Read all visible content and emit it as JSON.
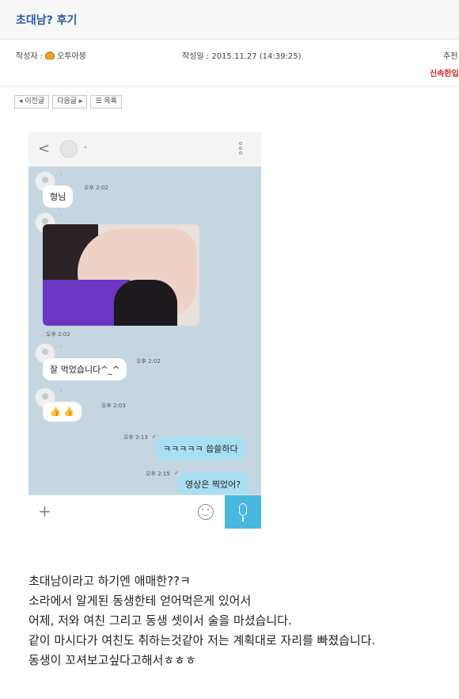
{
  "post": {
    "title": "초대남? 후기",
    "author_label": "작성자 :",
    "author": "오투아붕",
    "author_icon": "character-icon",
    "date_label": "작성일 : 2015.11.27 (14:39:25)",
    "recommend_label": "추천",
    "red_label": "신속한입"
  },
  "nav": {
    "prev": "◂ 이전글",
    "next": "다음글 ▸",
    "list": "☰ 목록"
  },
  "chat": {
    "header_name": "·",
    "messages": [
      {
        "sender_dot": "·",
        "text": "형님",
        "time": "오후 2:02"
      },
      {
        "sender_dot": "·",
        "kind": "photo",
        "time": "오후 2:02"
      },
      {
        "sender_dot": "·",
        "text": "잘 먹었습니다^_^",
        "time": "오후 2:02"
      },
      {
        "sender_dot": "·",
        "text": "👍 👍",
        "time": "오후 2:03"
      },
      {
        "text": "ㅋㅋㅋㅋㅋ 씁쓸하다",
        "time": "오후 2:13"
      },
      {
        "text": "영상은 찍었어?",
        "time": "오후 2:15"
      }
    ],
    "read_mark": "✓"
  },
  "body": {
    "lines": [
      "초대남이라고 하기엔 애매한??ㅋ",
      "소라에서 알게된 동생한테 얻어먹은게 있어서",
      "어제, 저와 여친 그리고 동생 셋이서 술을 마셨습니다.",
      "같이 마시다가 여친도 취하는것같아 저는 계획대로 자리를 빠졌습니다.",
      "동생이 꼬셔보고싶다고해서ㅎㅎㅎ"
    ]
  }
}
